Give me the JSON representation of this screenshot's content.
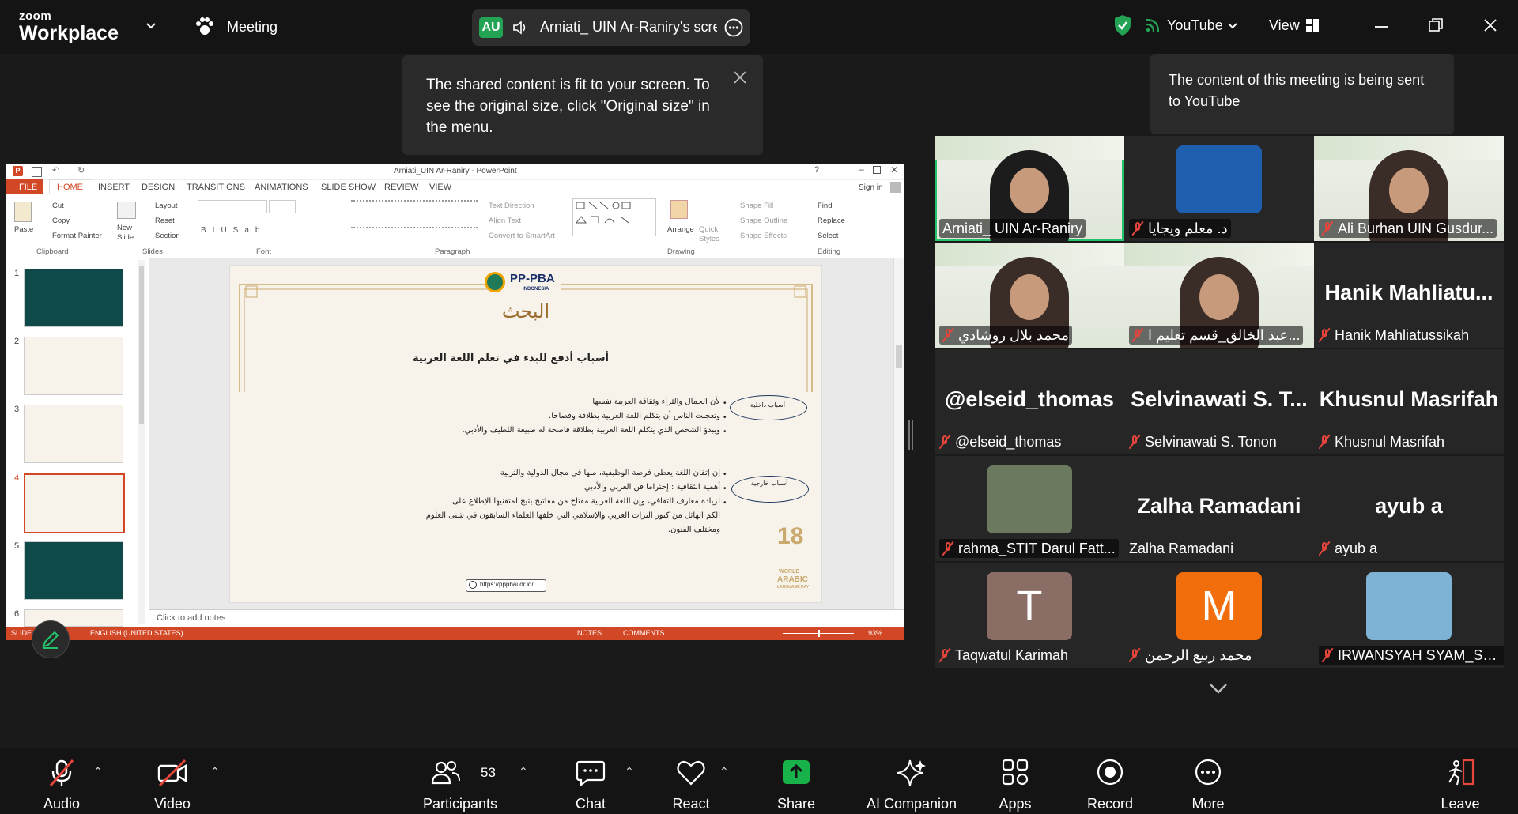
{
  "app": {
    "brand_small": "zoom",
    "brand_big": "Workplace",
    "meeting_label": "Meeting"
  },
  "share": {
    "badge": "AU",
    "title": "Arniati_ UIN Ar-Raniry's scre"
  },
  "topright": {
    "stream": "YouTube",
    "view": "View"
  },
  "tooltips": {
    "fit": "The shared content is fit to your screen. To see the original size, click \"Original size\" in the menu.",
    "youtube": "The content of this meeting is being sent to YouTube"
  },
  "ppt": {
    "title": "Arniati_UIN Ar-Raniry - PowerPoint",
    "signin": "Sign in",
    "tabs": [
      "FILE",
      "HOME",
      "INSERT",
      "DESIGN",
      "TRANSITIONS",
      "ANIMATIONS",
      "SLIDE SHOW",
      "REVIEW",
      "VIEW"
    ],
    "ribbon": {
      "paste": "Paste",
      "cut": "Cut",
      "copy": "Copy",
      "format_painter": "Format Painter",
      "new_slide": "New Slide",
      "layout": "Layout",
      "reset": "Reset",
      "section": "Section",
      "text_direction": "Text Direction",
      "align_text": "Align Text",
      "smartart": "Convert to SmartArt",
      "arrange": "Arrange",
      "quick_styles": "Quick Styles",
      "shape_fill": "Shape Fill",
      "shape_outline": "Shape Outline",
      "shape_effects": "Shape Effects",
      "find": "Find",
      "replace": "Replace",
      "select": "Select",
      "groups": [
        "Clipboard",
        "Slides",
        "Font",
        "Paragraph",
        "Drawing",
        "Editing"
      ]
    },
    "thumb_numbers": [
      "1",
      "2",
      "3",
      "4",
      "5",
      "6"
    ],
    "slide": {
      "logo": "PP-PBA",
      "logo_sub": "INDONESIA",
      "heading": "البحث",
      "subtitle": "أسباب أدفع للبدء في تعلم اللغة العربية",
      "oval1": "أسباب داخلية",
      "oval2": "أسباب خارجية",
      "lines1": [
        "لأن الجمال والثراء وثقافة العربية نفسها",
        "وتعجبت الناس أن يتكلم اللغة العربية بطلاقة وفصاحا.",
        "ويبدؤ الشخص الذي يتكلم اللغة العربية بطلاقة فاصحة له طبيعة اللطيف والأدبي."
      ],
      "lines2": [
        "إن إتقان اللغة يعطي فرصة الوظيفية، منها في مجال الدولية والتربية",
        "أهمية الثقافية : إحتراما فن العربي والأدبي",
        "لزيادة معارف الثقافي، وإن اللغة العربية مفتاح من مفاتيح يتيح لمتقنيها الإطلاع على",
        "الكم الهائل من كنوز التراث العربي والإسلامي التي خلفها العلماء السابقون في شتى العلوم",
        "ومختلف الفنون."
      ],
      "badge_num": "18",
      "badge_l1": "WORLD",
      "badge_l2": "ARABIC",
      "badge_l3": "LANGUAGE DAY",
      "url": "https://pppbai.or.id/"
    },
    "notes": "Click to add notes",
    "status": {
      "slide": "SLIDE",
      "lang": "ENGLISH (UNITED STATES)",
      "notes": "NOTES",
      "comments": "COMMENTS",
      "zoom": "93%"
    }
  },
  "participants": [
    {
      "label": "Arniati_ UIN Ar-Raniry",
      "muted": false,
      "tile": "video",
      "active": true
    },
    {
      "label": "د. معلم ويجايا",
      "muted": true,
      "tile": "photo"
    },
    {
      "label": "Ali Burhan UIN Gusdur...",
      "muted": true,
      "tile": "video"
    },
    {
      "label": "محمد بلال روشادي",
      "muted": true,
      "tile": "video"
    },
    {
      "label": "عبد الخالق_قسم تعليم ا...",
      "muted": true,
      "tile": "video"
    },
    {
      "label": "Hanik Mahliatussikah",
      "muted": true,
      "tile": "name",
      "big": "Hanik  Mahliatu..."
    },
    {
      "label": "@elseid_thomas",
      "muted": true,
      "tile": "name",
      "big": "@elseid_thomas"
    },
    {
      "label": "Selvinawati S. Tonon",
      "muted": true,
      "tile": "name",
      "big": "Selvinawati S. T..."
    },
    {
      "label": "Khusnul Masrifah",
      "muted": true,
      "tile": "name",
      "big": "Khusnul Masrifah"
    },
    {
      "label": "rahma_STIT Darul Fatt...",
      "muted": true,
      "tile": "photo"
    },
    {
      "label": "Zalha Ramadani",
      "muted": false,
      "tile": "name",
      "big": "Zalha Ramadani"
    },
    {
      "label": "ayub a",
      "muted": true,
      "tile": "name",
      "big": "ayub a"
    },
    {
      "label": "Taqwatul Karimah",
      "muted": true,
      "tile": "avatar",
      "letter": "T",
      "color": "#8a6e66"
    },
    {
      "label": "محمد ربيع الرحمن",
      "muted": true,
      "tile": "avatar",
      "letter": "M",
      "color": "#f26d0b"
    },
    {
      "label": "IRWANSYAH SYAM_STI...",
      "muted": true,
      "tile": "photo"
    }
  ],
  "toolbar": {
    "audio": "Audio",
    "video": "Video",
    "participants": "Participants",
    "participants_count": "53",
    "chat": "Chat",
    "react": "React",
    "share": "Share",
    "ai": "AI Companion",
    "apps": "Apps",
    "record": "Record",
    "more": "More",
    "leave": "Leave"
  },
  "colors": {
    "accent_green": "#23a455",
    "share_green": "#17b24a",
    "mute_red": "#e5453b",
    "ppt_red": "#d24726"
  }
}
